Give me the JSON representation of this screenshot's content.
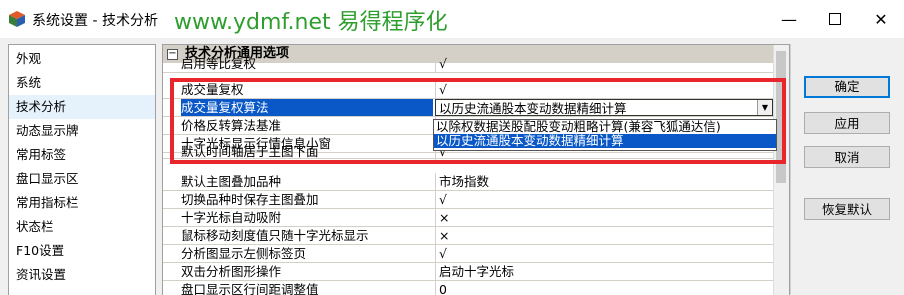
{
  "window": {
    "title": "系统设置 - 技术分析",
    "watermark": "www.ydmf.net 易得程序化"
  },
  "sidebar": {
    "items": [
      {
        "label": "外观"
      },
      {
        "label": "系统"
      },
      {
        "label": "技术分析",
        "selected": true
      },
      {
        "label": "动态显示牌"
      },
      {
        "label": "常用标签"
      },
      {
        "label": "盘口显示区"
      },
      {
        "label": "常用指标栏"
      },
      {
        "label": "状态栏"
      },
      {
        "label": "F10设置"
      },
      {
        "label": "资讯设置"
      }
    ]
  },
  "grid": {
    "section_header": "技术分析通用选项",
    "rows": [
      {
        "name": "启用等比复权",
        "value": "√"
      },
      {
        "name": "成交量复权",
        "value": "√"
      },
      {
        "name": "成交量复权算法",
        "value": "以历史流通股本变动数据精细计算",
        "selected": true,
        "dropdown": true
      },
      {
        "name": "价格反转算法基准",
        "value": ""
      },
      {
        "name": "十字光标显示行情信息小窗",
        "value": ""
      },
      {
        "name": "默认时间轴居于主图下面",
        "value": "√"
      },
      {
        "name": "默认主图叠加品种",
        "value": "市场指数"
      },
      {
        "name": "切换品种时保存主图叠加",
        "value": "√"
      },
      {
        "name": "十字光标自动吸附",
        "value": "×"
      },
      {
        "name": "鼠标移动刻度值只随十字光标显示",
        "value": "×"
      },
      {
        "name": "分析图显示左侧标签页",
        "value": "√"
      },
      {
        "name": "双击分析图形操作",
        "value": "启动十字光标"
      },
      {
        "name": "盘口显示区行间距调整值",
        "value": "0"
      }
    ],
    "dropdown_options": [
      {
        "label": "以除权数据送股配股变动粗略计算(兼容飞狐通达信)"
      },
      {
        "label": "以历史流通股本变动数据精细计算",
        "highlighted": true
      }
    ]
  },
  "buttons": {
    "ok": "确定",
    "apply": "应用",
    "cancel": "取消",
    "restore_defaults": "恢复默认"
  },
  "colors": {
    "selection": "#0a58c8",
    "annotation_frame": "#e8262c",
    "watermark": "#2e9e2e"
  }
}
